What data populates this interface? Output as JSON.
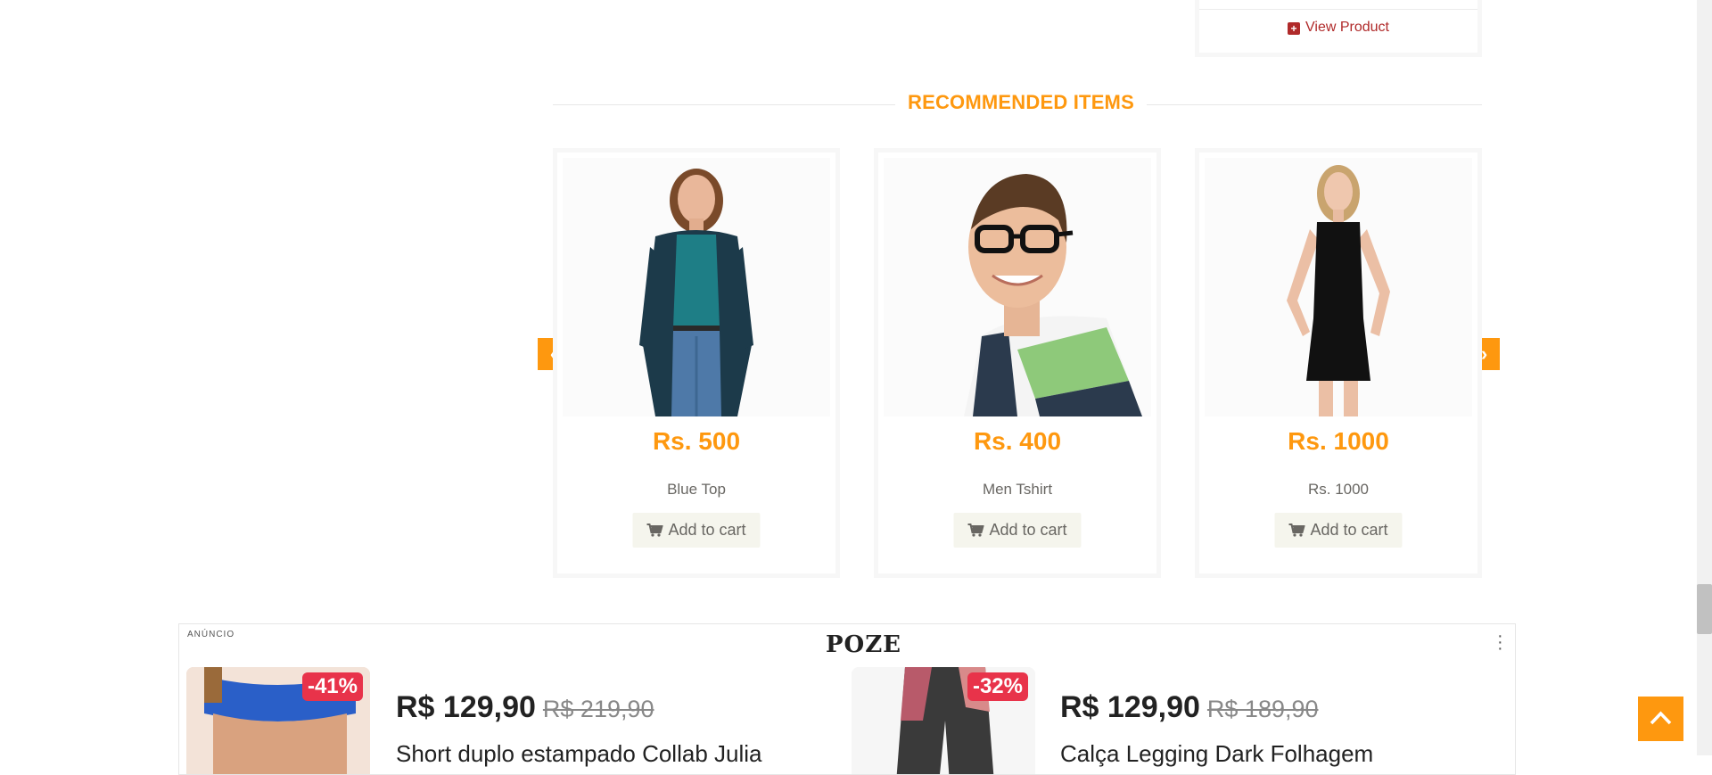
{
  "previous_card": {
    "view_product_label": "View Product"
  },
  "recommended": {
    "title": "RECOMMENDED ITEMS",
    "items": [
      {
        "price": "Rs. 500",
        "name": "Blue Top",
        "cart_label": "Add to cart",
        "image": "woman-in-teal-top-and-dark-cardigan"
      },
      {
        "price": "Rs. 400",
        "name": "Men Tshirt",
        "cart_label": "Add to cart",
        "image": "smiling-man-with-glasses"
      },
      {
        "price": "Rs. 1000",
        "name": "Rs. 1000",
        "cart_label": "Add to cart",
        "image": "woman-in-black-dress"
      }
    ],
    "prev_icon": "chevron-left-icon",
    "next_icon": "chevron-right-icon"
  },
  "ad": {
    "label": "ANÚNCIO",
    "brand": "POZE",
    "products": [
      {
        "discount": "-41%",
        "price": "R$ 129,90",
        "old_price": "R$ 219,90",
        "title": "Short duplo estampado Collab Julia"
      },
      {
        "discount": "-32%",
        "price": "R$ 129,90",
        "old_price": "R$ 189,90",
        "title": "Calça Legging Dark Folhagem"
      }
    ]
  },
  "colors": {
    "accent": "#fe980f",
    "badge": "#e8334a",
    "view_link": "#b02a2a"
  }
}
